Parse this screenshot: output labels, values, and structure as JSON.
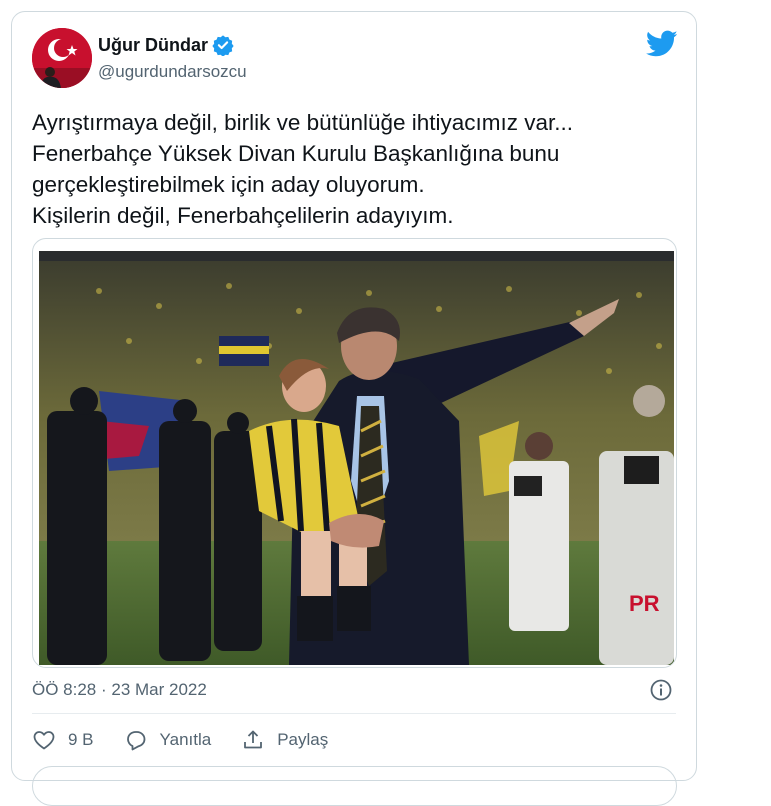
{
  "tweet": {
    "author_name": "Uğur Dündar",
    "author_handle": "@ugurdundarsozcu",
    "text_lines": [
      "Ayrıştırmaya değil, birlik ve bütünlüğe ihtiyacımız var...",
      "Fenerbahçe Yüksek Divan Kurulu Başkanlığına bunu",
      "gerçekleştirebilmek için aday oluyorum.",
      "Kişilerin değil, Fenerbahçelilerin adayıyım."
    ],
    "timestamp": "ÖÖ 8:28 · 23 Mar 2022"
  },
  "actions": {
    "like_count": "9 B",
    "reply_label": "Yanıtla",
    "share_label": "Paylaş"
  },
  "icons": {
    "verified": "verified-badge-icon",
    "logo": "twitter-bird-icon",
    "info": "info-icon",
    "like": "heart-icon",
    "reply": "speech-bubble-icon",
    "share": "share-icon"
  },
  "colors": {
    "brand": "#1d9bf0",
    "text": "#0f1419",
    "secondary": "#536471",
    "border": "#cfd9de"
  }
}
